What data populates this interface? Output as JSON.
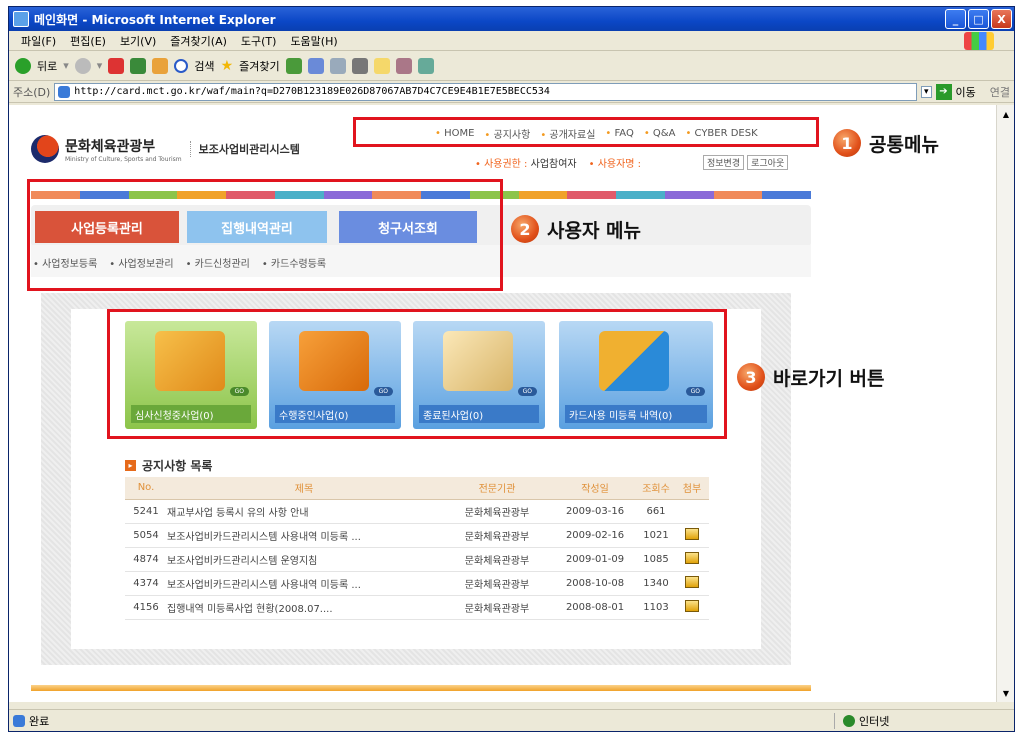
{
  "window": {
    "title": "메인화면 - Microsoft Internet Explorer",
    "controls": [
      "_",
      "□",
      "X"
    ]
  },
  "menubar": [
    "파일(F)",
    "편집(E)",
    "보기(V)",
    "즐겨찾기(A)",
    "도구(T)",
    "도움말(H)"
  ],
  "toolbar": {
    "back": "뒤로",
    "search": "검색",
    "favorites": "즐겨찾기"
  },
  "address": {
    "label": "주소(D)",
    "url": "http://card.mct.go.kr/waf/main?q=D270B123189E026D87067AB7D4C7CE9E4B1E7E5BECC534",
    "go": "이동",
    "links": "연결"
  },
  "site": {
    "org_name": "문화체육관광부",
    "org_sub": "Ministry of Culture, Sports and Tourism",
    "system_name": "보조사업비관리시스템"
  },
  "top_menu": [
    "HOME",
    "공지사항",
    "공개자료실",
    "FAQ",
    "Q&A",
    "CYBER DESK"
  ],
  "user_info": {
    "perm_label": "• 사용권한 :",
    "perm_value": "사업참여자",
    "name_label": "• 사용자명 :",
    "btn_edit": "정보변경",
    "btn_logout": "로그아웃"
  },
  "main_tabs": [
    "사업등록관리",
    "집행내역관리",
    "청구서조회"
  ],
  "sub_menu": [
    "사업정보등록",
    "사업정보관리",
    "카드신청관리",
    "카드수령등록"
  ],
  "callouts": [
    {
      "num": "1",
      "text": "공통메뉴"
    },
    {
      "num": "2",
      "text": "사용자 메뉴"
    },
    {
      "num": "3",
      "text": "바로가기 버튼"
    }
  ],
  "quick_cards": [
    {
      "label": "심사신청중사업(0)",
      "go": "GO"
    },
    {
      "label": "수행중인사업(0)",
      "go": "GO"
    },
    {
      "label": "종료된사업(0)",
      "go": "GO"
    },
    {
      "label": "카드사용 미등록 내역(0)",
      "go": "GO"
    }
  ],
  "notice": {
    "title": "공지사항 목록",
    "columns": [
      "No.",
      "제목",
      "전문기관",
      "작성일",
      "조회수",
      "첨부"
    ],
    "rows": [
      {
        "no": "5241",
        "title": "재교부사업 등록시 유의 사항 안내",
        "org": "문화체육관광부",
        "date": "2009-03-16",
        "views": "661",
        "attach": false
      },
      {
        "no": "5054",
        "title": "보조사업비카드관리시스템 사용내역 미등록 ...",
        "org": "문화체육관광부",
        "date": "2009-02-16",
        "views": "1021",
        "attach": true
      },
      {
        "no": "4874",
        "title": "보조사업비카드관리시스템 운영지침",
        "org": "문화체육관광부",
        "date": "2009-01-09",
        "views": "1085",
        "attach": true
      },
      {
        "no": "4374",
        "title": "보조사업비카드관리시스템 사용내역 미등록 ...",
        "org": "문화체육관광부",
        "date": "2008-10-08",
        "views": "1340",
        "attach": true
      },
      {
        "no": "4156",
        "title": "집행내역 미등록사업 현황(2008.07....",
        "org": "문화체육관광부",
        "date": "2008-08-01",
        "views": "1103",
        "attach": true
      }
    ]
  },
  "status": {
    "done": "완료",
    "zone": "인터넷"
  },
  "colors": {
    "accent_red": "#e1141e",
    "tab1": "#d9533a",
    "tab2": "#8ec3ee",
    "tab3": "#6a8de0",
    "card1": "#8cc44a",
    "card_blue": "#4a90d8"
  }
}
